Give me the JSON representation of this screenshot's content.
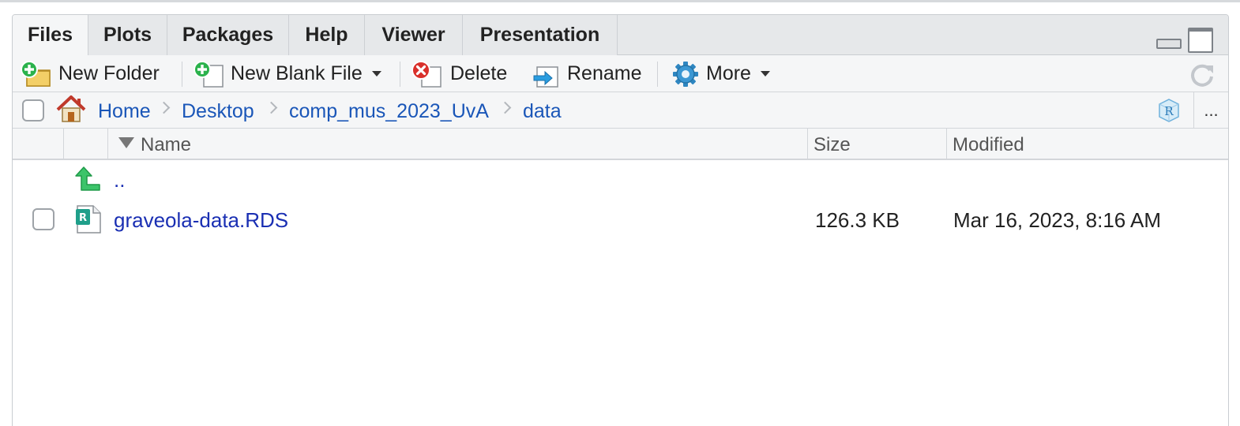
{
  "tabs": [
    {
      "label": "Files",
      "active": true
    },
    {
      "label": "Plots",
      "active": false
    },
    {
      "label": "Packages",
      "active": false
    },
    {
      "label": "Help",
      "active": false
    },
    {
      "label": "Viewer",
      "active": false
    },
    {
      "label": "Presentation",
      "active": false
    }
  ],
  "toolbar": {
    "new_folder": "New Folder",
    "new_blank_file": "New Blank File",
    "delete": "Delete",
    "rename": "Rename",
    "more": "More"
  },
  "breadcrumb": [
    "Home",
    "Desktop",
    "comp_mus_2023_UvA",
    "data"
  ],
  "path_more": "...",
  "columns": {
    "name": "Name",
    "size": "Size",
    "modified": "Modified"
  },
  "parent_link": "..",
  "files": [
    {
      "name": "graveola-data.RDS",
      "size": "126.3 KB",
      "modified": "Mar 16, 2023, 8:16 AM",
      "icon": "rds-file-icon"
    }
  ],
  "colors": {
    "link": "#1a2fb3",
    "breadcrumb_link": "#1a56b8",
    "accent_green": "#2bb24c",
    "delete_red": "#d9302b",
    "gear_blue": "#2e86c1"
  }
}
